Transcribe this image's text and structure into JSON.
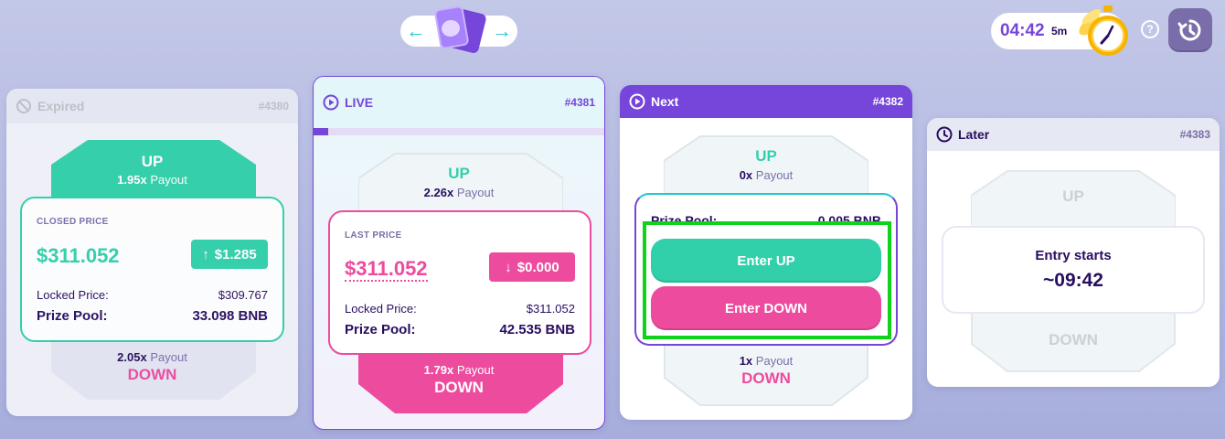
{
  "header": {
    "nav_left_icon": "arrow-left-icon",
    "nav_right_icon": "arrow-right-icon",
    "timer_value": "04:42",
    "timer_unit": "5m",
    "help_label": "?",
    "history_icon": "history-icon"
  },
  "cards": {
    "expired": {
      "status": "Expired",
      "epoch": "#4380",
      "up_label": "UP",
      "up_multiplier": "1.95x",
      "payout_word": "Payout",
      "price_label": "CLOSED PRICE",
      "price": "$311.052",
      "change": "$1.285",
      "locked_label": "Locked Price:",
      "locked_value": "$309.767",
      "pool_label": "Prize Pool:",
      "pool_value": "33.098 BNB",
      "down_multiplier": "2.05x",
      "down_label": "DOWN"
    },
    "live": {
      "status": "LIVE",
      "epoch": "#4381",
      "progress": 0.05,
      "up_label": "UP",
      "up_multiplier": "2.26x",
      "payout_word": "Payout",
      "price_label": "LAST PRICE",
      "price": "$311.052",
      "change": "$0.000",
      "locked_label": "Locked Price:",
      "locked_value": "$311.052",
      "pool_label": "Prize Pool:",
      "pool_value": "42.535 BNB",
      "down_multiplier": "1.79x",
      "down_label": "DOWN"
    },
    "next": {
      "status": "Next",
      "epoch": "#4382",
      "up_label": "UP",
      "up_multiplier": "0x",
      "payout_word": "Payout",
      "pool_label": "Prize Pool:",
      "pool_value": "0.005 BNB",
      "enter_up": "Enter UP",
      "enter_down": "Enter DOWN",
      "down_multiplier": "1x",
      "down_label": "DOWN"
    },
    "later": {
      "status": "Later",
      "epoch": "#4383",
      "up_label": "UP",
      "entry_label": "Entry starts",
      "entry_time": "~09:42",
      "down_label": "DOWN"
    }
  },
  "colors": {
    "up": "#31d0aa",
    "down": "#ed4b9e",
    "purple": "#7645d9",
    "text": "#280d5f",
    "highlight": "#0fd21a"
  }
}
